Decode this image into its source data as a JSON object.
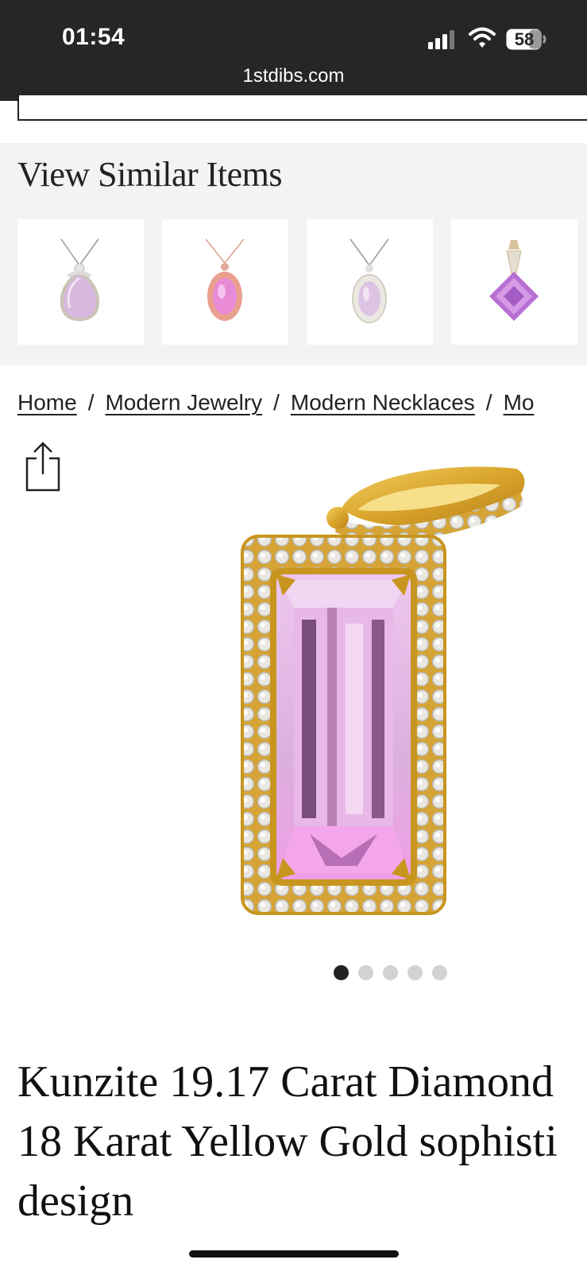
{
  "status_bar": {
    "time": "01:54",
    "url": "1stdibs.com",
    "battery": "58",
    "icons": [
      "signal-icon",
      "wifi-icon",
      "battery-icon"
    ]
  },
  "similar_items": {
    "title": "View Similar Items",
    "items": [
      {
        "icon": "pear-pendant-thumbnail"
      },
      {
        "icon": "oval-rose-pendant-thumbnail"
      },
      {
        "icon": "oval-halo-pendant-thumbnail"
      },
      {
        "icon": "cushion-pendant-thumbnail"
      }
    ]
  },
  "breadcrumb": [
    "Home",
    "Modern Jewelry",
    "Modern Necklaces",
    "Mo"
  ],
  "breadcrumb_separator": "/",
  "carousel": {
    "count": 5,
    "active": 1
  },
  "product": {
    "title_lines": [
      "Kunzite 19.17 Carat Diamond",
      "18 Karat Yellow Gold sophisti",
      "design"
    ]
  },
  "colors": {
    "status_bar": "#262626",
    "similar_bg": "#f3f3f3",
    "gold": "#d9a52b",
    "kunzite": "#e7a9e4"
  }
}
